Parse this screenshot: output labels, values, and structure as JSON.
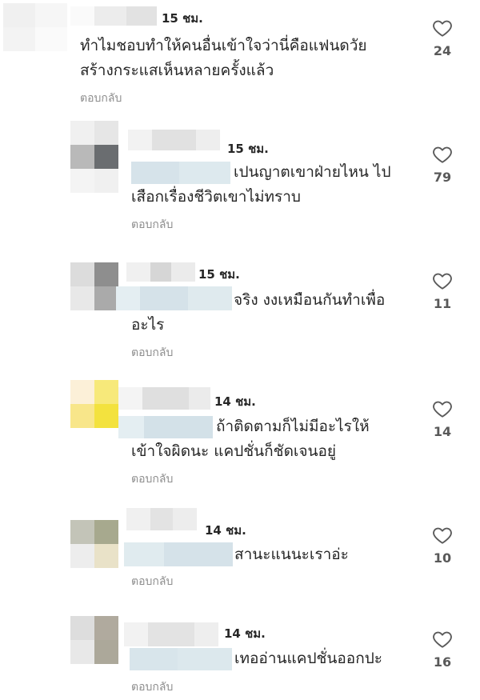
{
  "comments": [
    {
      "time": "15 ชม.",
      "lines": [
        "ทำไมชอบทำให้คนอื่นเข้าใจว่านี่คือแฟนดวัย",
        "สร้างกระแสเห็นหลายครั้งแล้ว"
      ],
      "reply": "ตอบกลับ",
      "likes": "24"
    },
    {
      "time": "15 ชม.",
      "lines": [
        "เปนญาตเขาฝ่ายไหน ไป",
        "เสือกเรื่องชีวิตเขาไม่ทราบ"
      ],
      "reply": "ตอบกลับ",
      "likes": "79"
    },
    {
      "time": "15 ชม.",
      "lines": [
        "จริง งงเหมือนกันทำเพื่อ",
        "อะไร"
      ],
      "reply": "ตอบกลับ",
      "likes": "11"
    },
    {
      "time": "14 ชม.",
      "lines": [
        "ถ้าติดตามก็ไม่มีอะไรให้",
        "เข้าใจผิดนะ แคปชั่นก็ชัดเจนอยู่"
      ],
      "reply": "ตอบกลับ",
      "likes": "14"
    },
    {
      "time": "14 ชม.",
      "lines": [
        "สานะแนนะเราอ่ะ"
      ],
      "reply": "ตอบกลับ",
      "likes": "10"
    },
    {
      "time": "14 ชม.",
      "lines": [
        "เทออ่านแคปชั่นออกปะ"
      ],
      "reply": "ตอบกลับ",
      "likes": "16"
    }
  ],
  "icons": {
    "like": "heart-outline-icon"
  },
  "colors": {
    "text": "#262626",
    "muted": "#8e8e8e",
    "mention_blur": "#d9e6ec"
  }
}
